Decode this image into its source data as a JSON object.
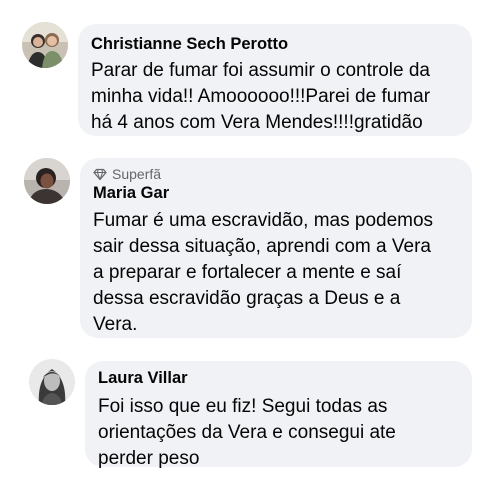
{
  "comments": [
    {
      "author": "Christianne Sech Perotto",
      "avatar_icon": "profile-photo-two-women",
      "badge": null,
      "text": "Parar de fumar foi assumir o controle da\nminha vida!! Amoooooo!!!Parei de fumar\nhá 4 anos com Vera Mendes!!!!gratidão"
    },
    {
      "author": "Maria Gar",
      "avatar_icon": "profile-photo-woman",
      "badge": {
        "icon": "diamond-icon",
        "label": "Superfã"
      },
      "text": "Fumar é uma escravidão, mas podemos\nsair dessa situação, aprendi com a Vera\na preparar e fortalecer a mente e saí\ndessa escravidão graças a Deus e a\nVera."
    },
    {
      "author": "Laura Villar",
      "avatar_icon": "profile-photo-woman-bw",
      "badge": null,
      "text": "Foi isso que eu fiz! Segui todas as\norientações da Vera e consegui ate\nperder peso"
    }
  ],
  "colors": {
    "bubble_background": "#f0f2f5",
    "text": "#050505",
    "secondary_text": "#65676b"
  }
}
